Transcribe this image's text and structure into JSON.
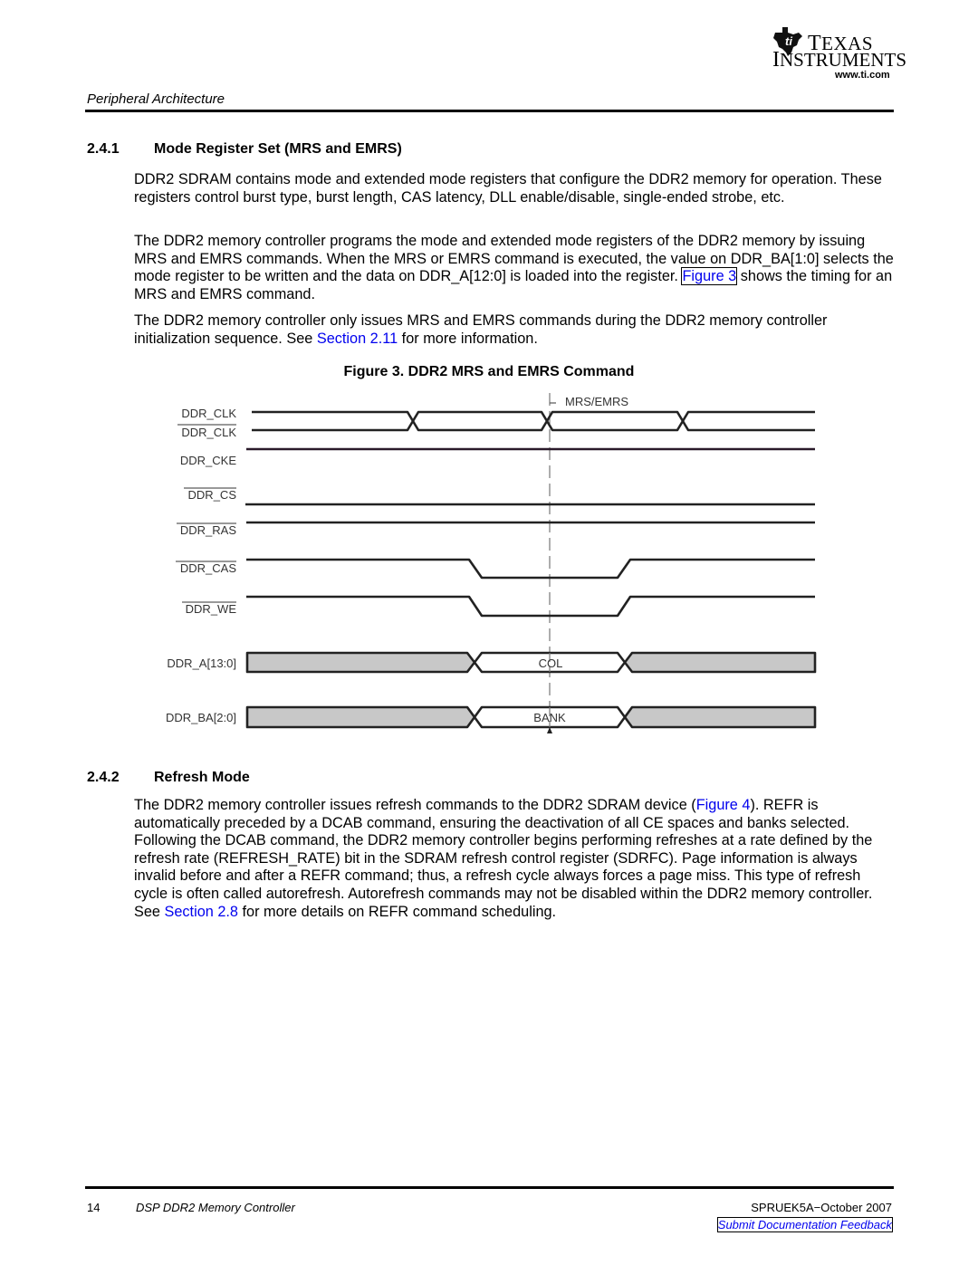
{
  "header": {
    "section_title": "Peripheral Architecture",
    "logo": {
      "line1_first": "T",
      "line1_rest": "EXAS",
      "line2_first": "I",
      "line2_rest": "NSTRUMENTS",
      "url": "www.ti.com",
      "icon": "ti-state-logo-icon"
    }
  },
  "section_241": {
    "number": "2.4.1",
    "title": "Mode Register Set (MRS and EMRS)",
    "para1": "DDR2 SDRAM contains mode and extended mode registers that configure the DDR2 memory for operation. These registers control burst type, burst length, CAS latency, DLL enable/disable, single-ended strobe, etc.",
    "para2_before": "The DDR2 memory controller programs the mode and extended mode registers of the DDR2 memory by issuing MRS and EMRS commands. When the MRS or EMRS command is executed, the value on DDR_BA[1:0] selects the mode register to be written and the data on DDR_A[12:0] is loaded into the register. ",
    "para2_link": "Figure 3",
    "para2_after": " shows the timing for an MRS and EMRS command.",
    "para3_before": "The DDR2 memory controller only issues MRS and EMRS commands during the DDR2 memory controller initialization sequence. See ",
    "para3_link": "Section 2.11",
    "para3_after": " for more information."
  },
  "figure3": {
    "caption": "Figure 3. DDR2 MRS and EMRS Command",
    "marker_label": "MRS/EMRS",
    "signals": {
      "clk": "DDR_CLK",
      "clk_n": "DDR_CLK",
      "cke": "DDR_CKE",
      "cs": "DDR_CS",
      "ras": "DDR_RAS",
      "cas": "DDR_CAS",
      "we": "DDR_WE",
      "addr": "DDR_A[13:0]",
      "bank": "DDR_BA[2:0]"
    },
    "bus_values": {
      "addr": "COL",
      "bank": "BANK"
    }
  },
  "section_242": {
    "number": "2.4.2",
    "title": "Refresh Mode",
    "para_before": "The DDR2 memory controller issues refresh commands to the DDR2 SDRAM device (",
    "para_link1": "Figure 4",
    "para_mid": "). REFR is automatically preceded by a DCAB command, ensuring the deactivation of all CE spaces and banks selected. Following the DCAB command, the DDR2 memory controller begins performing refreshes at a rate defined by the refresh rate (REFRESH_RATE) bit in the SDRAM refresh control register (SDRFC). Page information is always invalid before and after a REFR command; thus, a refresh cycle always forces a page miss. This type of refresh cycle is often called autorefresh. Autorefresh commands may not be disabled within the DDR2 memory controller. See ",
    "para_link2": "Section 2.8",
    "para_after": " for more details on REFR command scheduling."
  },
  "footer": {
    "page_number": "14",
    "doc_title": "DSP DDR2 Memory Controller",
    "doc_id": "SPRUEK5A−October 2007",
    "feedback_link": "Submit Documentation Feedback"
  }
}
